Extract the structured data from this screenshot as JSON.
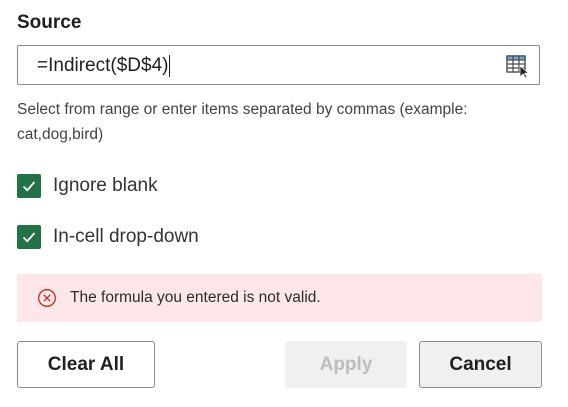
{
  "source": {
    "label": "Source",
    "value": "=Indirect($D$4)",
    "range_button_icon": "range-select-icon"
  },
  "help_text": "Select from range or enter items separated by commas (example: cat,dog,bird)",
  "options": [
    {
      "label": "Ignore blank",
      "checked": true
    },
    {
      "label": "In-cell drop-down",
      "checked": true
    }
  ],
  "error": {
    "icon": "error-circle-icon",
    "message": "The formula you entered is not valid."
  },
  "buttons": {
    "clear_all": "Clear All",
    "apply": "Apply",
    "apply_disabled": true,
    "cancel": "Cancel"
  },
  "colors": {
    "checkbox_fill": "#217346",
    "error_background": "#fde7e9",
    "error_icon": "#c42b1c"
  }
}
